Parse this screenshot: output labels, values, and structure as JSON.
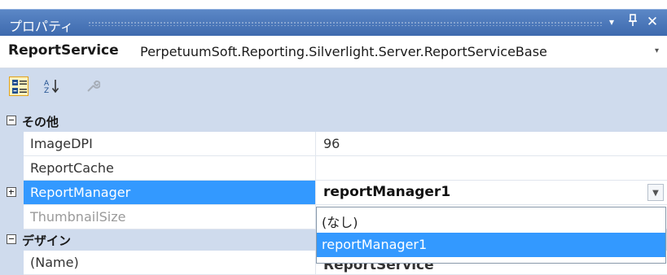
{
  "titlebar": {
    "title": "プロパティ",
    "buttons": [
      "▾",
      "ᛘ",
      "✕"
    ]
  },
  "object_selector": {
    "name": "ReportService",
    "type": "PerpetuumSoft.Reporting.Silverlight.Server.ReportServiceBase"
  },
  "toolbar": {
    "categorized_icon": "categorized-icon",
    "alphabetical_icon": "alphabetical-icon",
    "property_pages_icon": "wrench-icon"
  },
  "grid": {
    "category_other": "その他",
    "category_design": "デザイン",
    "rows": [
      {
        "name": "ImageDPI",
        "value": "96"
      },
      {
        "name": "ReportCache",
        "value": ""
      },
      {
        "name": "ReportManager",
        "value": "reportManager1"
      },
      {
        "name": "ThumbnailSize",
        "value": ""
      },
      {
        "name": "(Name)",
        "value": "ReportService"
      }
    ]
  },
  "dropdown": {
    "options": [
      "(なし)",
      "reportManager1"
    ],
    "selected": "reportManager1"
  },
  "colors": {
    "titlebar": "#4a76b8",
    "selection": "#3399ff",
    "gutter": "#cfdbed"
  }
}
